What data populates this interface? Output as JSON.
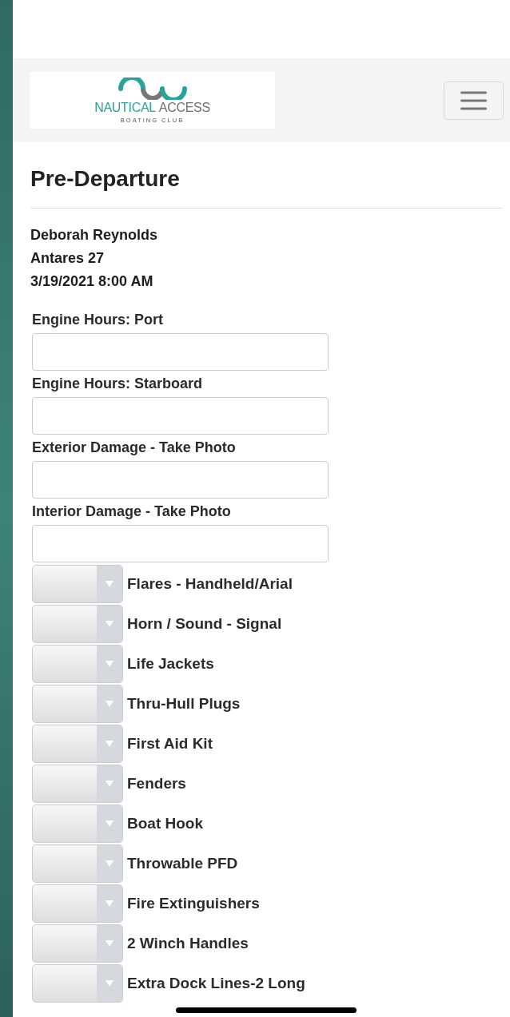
{
  "header": {
    "logo": {
      "primary": "NAUTICAL",
      "secondary": "ACCESS",
      "tagline": "BOATING CLUB"
    }
  },
  "title": "Pre-Departure",
  "booking": [
    "Deborah Reynolds",
    "Antares 27",
    "3/19/2021 8:00 AM"
  ],
  "fields": [
    {
      "label": "Engine Hours: Port"
    },
    {
      "label": "Engine Hours: Starboard"
    },
    {
      "label": "Exterior Damage - Take Photo"
    },
    {
      "label": "Interior Damage - Take Photo"
    }
  ],
  "checks": [
    {
      "label": "Flares - Handheld/Arial"
    },
    {
      "label": "Horn / Sound - Signal"
    },
    {
      "label": "Life Jackets"
    },
    {
      "label": "Thru-Hull Plugs"
    },
    {
      "label": "First Aid Kit"
    },
    {
      "label": "Fenders"
    },
    {
      "label": "Boat Hook"
    },
    {
      "label": "Throwable PFD"
    },
    {
      "label": "Fire Extinguishers"
    },
    {
      "label": "2 Winch Handles"
    },
    {
      "label": "Extra Dock Lines-2 Long"
    }
  ]
}
